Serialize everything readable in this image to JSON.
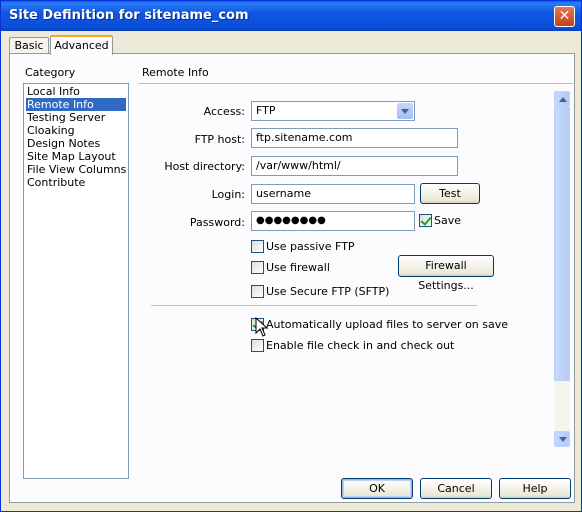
{
  "window": {
    "title": "Site Definition for sitename_com",
    "close_glyph": "✕"
  },
  "tabs": [
    {
      "label": "Basic"
    },
    {
      "label": "Advanced"
    }
  ],
  "category": {
    "label": "Category",
    "items": [
      {
        "label": "Local Info"
      },
      {
        "label": "Remote Info"
      },
      {
        "label": "Testing Server"
      },
      {
        "label": "Cloaking"
      },
      {
        "label": "Design Notes"
      },
      {
        "label": "Site Map Layout"
      },
      {
        "label": "File View Columns"
      },
      {
        "label": "Contribute"
      }
    ],
    "selected": "Remote Info"
  },
  "remote": {
    "section_title": "Remote Info",
    "access": {
      "label": "Access:",
      "value": "FTP"
    },
    "ftp_host": {
      "label": "FTP host:",
      "value": "ftp.sitename.com"
    },
    "host_dir": {
      "label": "Host directory:",
      "value": "/var/www/html/"
    },
    "login": {
      "label": "Login:",
      "value": "username",
      "test_label": "Test"
    },
    "password": {
      "label": "Password:",
      "value": "●●●●●●●●",
      "save_label": "Save",
      "save_checked": true
    },
    "passive_ftp": {
      "label": "Use passive FTP",
      "checked": false
    },
    "firewall": {
      "label": "Use firewall",
      "checked": false
    },
    "firewall_settings_label": "Firewall Settings...",
    "sftp": {
      "label": "Use Secure FTP (SFTP)",
      "checked": false
    },
    "auto_upload": {
      "label": "Automatically upload files to server on save",
      "checked": true
    },
    "checkin": {
      "label": "Enable file check in and check out",
      "checked": false
    }
  },
  "footer": {
    "ok": "OK",
    "cancel": "Cancel",
    "help": "Help"
  },
  "colors": {
    "title_bar": "#0a4fd8",
    "selection": "#316ac5",
    "dialog_bg": "#ece9d8"
  }
}
